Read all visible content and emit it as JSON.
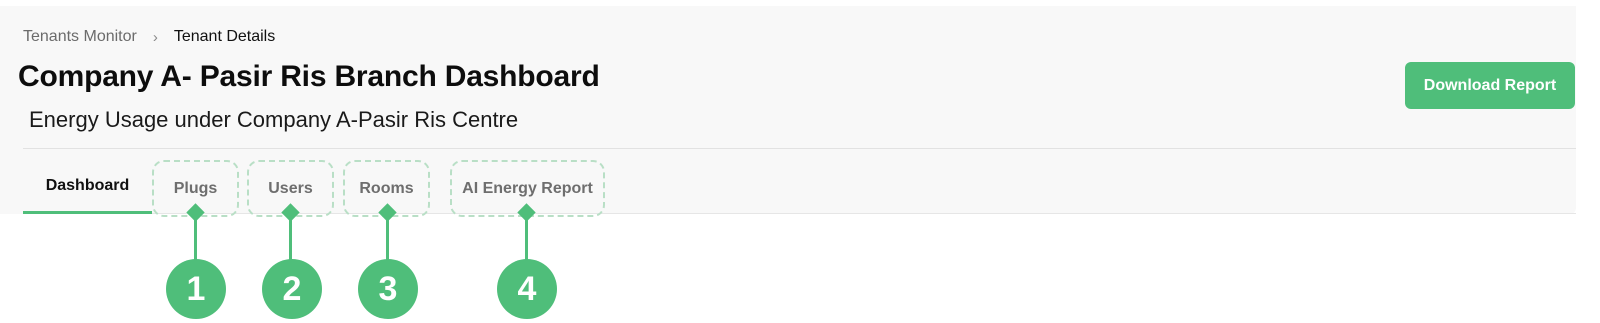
{
  "breadcrumb": {
    "parent": "Tenants Monitor",
    "separator": "›",
    "current": "Tenant Details"
  },
  "header": {
    "title": "Company A- Pasir Ris Branch Dashboard",
    "subtitle": "Energy Usage under Company A-Pasir Ris Centre",
    "download_label": "Download Report"
  },
  "tabs": [
    {
      "label": "Dashboard",
      "active": true
    },
    {
      "label": "Plugs",
      "active": false
    },
    {
      "label": "Users",
      "active": false
    },
    {
      "label": "Rooms",
      "active": false
    },
    {
      "label": "AI Energy Report",
      "active": false
    }
  ],
  "callouts": [
    "1",
    "2",
    "3",
    "4"
  ],
  "colors": {
    "accent": "#4fbe7a",
    "panel_background": "#f8f8f8",
    "dashed_outline": "#b9dfc6"
  }
}
